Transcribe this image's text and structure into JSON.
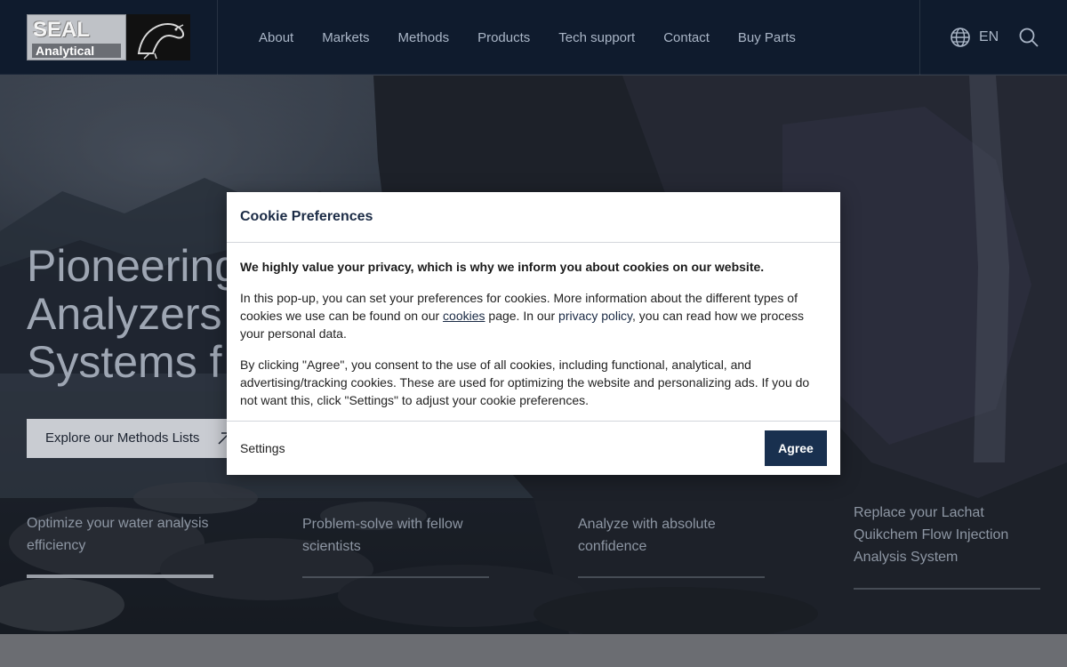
{
  "brand": {
    "word1": "SEAL",
    "word2": "Analytical"
  },
  "nav": {
    "items": [
      "About",
      "Markets",
      "Methods",
      "Products",
      "Tech support",
      "Contact",
      "Buy Parts"
    ]
  },
  "header_tools": {
    "language": "EN"
  },
  "hero": {
    "title_line1": "Pioneering",
    "title_line2": "Analyzers",
    "title_line3": "Systems f",
    "cta_label": "Explore our Methods Lists",
    "features": [
      "Optimize your water analysis efficiency",
      "Problem-solve with fellow scientists",
      "Analyze with absolute confidence",
      "Replace your Lachat Quikchem Flow Injection Analysis System"
    ],
    "active_feature": 1
  },
  "cookie_modal": {
    "title": "Cookie Preferences",
    "lead": "We highly value your privacy, which is why we inform you about cookies on our website.",
    "p1_a": "In this pop-up, you can set your preferences for cookies. More information about the different types of cookies we use can be found on our ",
    "p1_link_cookies": "cookies",
    "p1_b": " page. In our ",
    "p1_link_privacy": "privacy policy",
    "p1_c": ", you can read how we process your personal data.",
    "p2": "By clicking \"Agree\", you consent to the use of all cookies, including functional, analytical, and advertising/tracking cookies. These are used for optimizing the website and personalizing ads. If you do not want this, click \"Settings\" to adjust your cookie preferences.",
    "settings_label": "Settings",
    "agree_label": "Agree"
  },
  "colors": {
    "header_bg": "#0e1a2c",
    "accent": "#19304f",
    "nav_text": "#aab6c7"
  },
  "icons": [
    "globe-icon",
    "search-icon",
    "arrow-up-right-icon",
    "seal-logo-icon"
  ]
}
